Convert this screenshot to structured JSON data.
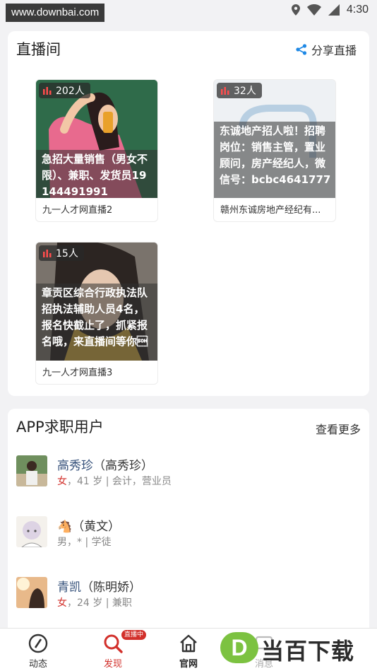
{
  "status_bar": {
    "url_watermark": "www.downbai.com",
    "time": "4:30"
  },
  "live_section": {
    "title": "直播间",
    "share_label": "分享直播",
    "rooms": [
      {
        "viewers": "202人",
        "overlay": "急招大量销售（男女不限）、兼职、发货员19144491991",
        "host": "九一人才网直播2"
      },
      {
        "viewers": "32人",
        "overlay": "东诚地产招人啦！招聘岗位：销售主管，置业顾问，房产经纪人，微信号：bcbc4641777",
        "host": "赣州东诚房地产经纪有..."
      },
      {
        "viewers": "15人",
        "overlay": "章贡区综合行政执法队招执法辅助人员4名，报名快截止了，抓紧报名哦，来直播间等你\u0001",
        "host": "九一人才网直播3"
      }
    ]
  },
  "users_section": {
    "title": "APP求职用户",
    "more_label": "查看更多",
    "users": [
      {
        "nick": "高秀珍",
        "real": "（高秀珍）",
        "gender": "女",
        "info": "，41 岁 | 会计，营业员"
      },
      {
        "nick": "🐴",
        "real": "（黄文）",
        "gender": "男",
        "info": "，* | 学徒"
      },
      {
        "nick": "青凯",
        "real": "（陈明娇）",
        "gender": "女",
        "info": "，24 岁 | 兼职"
      }
    ]
  },
  "bottom_nav": {
    "items": [
      {
        "label": "动态"
      },
      {
        "label": "发现",
        "tag": "直播中"
      },
      {
        "label": "官网"
      },
      {
        "label": "消息"
      }
    ]
  },
  "logo_watermark": {
    "letter": "D",
    "text": "当百下载"
  },
  "colors": {
    "accent_red": "#d2302b",
    "share_blue": "#1e88e5",
    "name_blue": "#34507a"
  }
}
